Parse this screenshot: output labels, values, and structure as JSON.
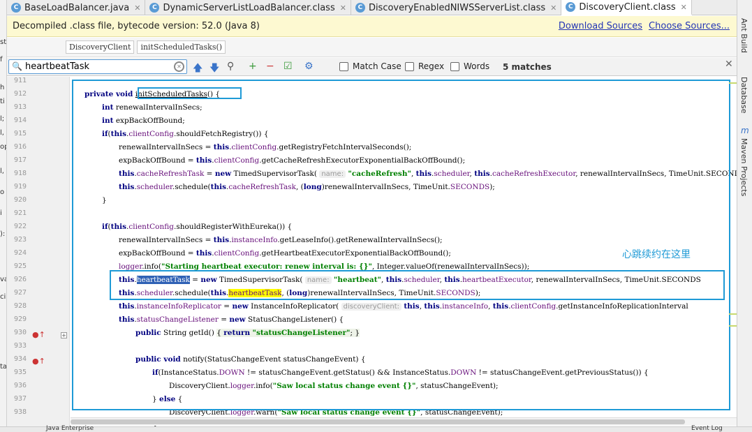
{
  "tabs": [
    {
      "label": "BaseLoadBalancer.java",
      "icon": "class-icon"
    },
    {
      "label": "DynamicServerListLoadBalancer.class",
      "icon": "class-icon"
    },
    {
      "label": "DiscoveryEnabledNIWSServerList.class",
      "icon": "class-icon"
    },
    {
      "label": "DiscoveryClient.class",
      "icon": "class-icon",
      "active": true
    }
  ],
  "left_fragments": [
    "st",
    "f",
    "h",
    "ti",
    "l;",
    "l,",
    "op",
    "l,",
    "o",
    "i",
    "):",
    "va",
    "ci",
    "tasing"
  ],
  "infobar": {
    "text": "Decompiled .class file, bytecode version: 52.0 (Java 8)",
    "download": "Download Sources",
    "choose": "Choose Sources..."
  },
  "breadcrumbs": [
    "DiscoveryClient",
    "initScheduledTasks()"
  ],
  "find": {
    "value": "heartbeatTask",
    "match_case": "Match Case",
    "regex": "Regex",
    "words": "Words",
    "matches": "5 matches"
  },
  "right_tools": [
    "Ant Build",
    "Database",
    "Maven Projects"
  ],
  "annotation": "心跳续约在这里",
  "bottom": {
    "left": "Java Enterprise",
    "right": "Event Log"
  },
  "line_numbers": [
    "911",
    "912",
    "913",
    "914",
    "915",
    "916",
    "917",
    "918",
    "919",
    "920",
    "921",
    "922",
    "923",
    "924",
    "925",
    "926",
    "927",
    "928",
    "929",
    "930",
    "933",
    "934",
    "935",
    "936",
    "937",
    "938"
  ]
}
